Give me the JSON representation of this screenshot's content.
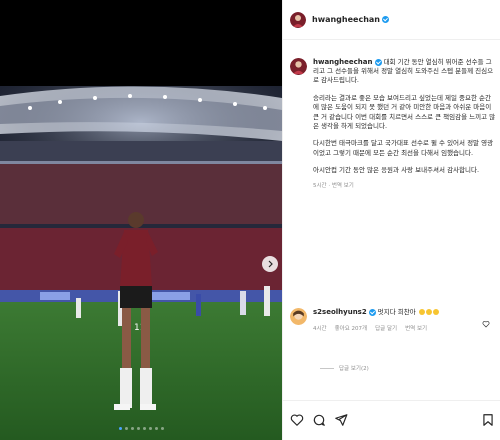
{
  "post": {
    "username": "hwangheechan",
    "caption": [
      "대회 기간 동안 열심히 뛰어준 선수들 그리고 그 선수들을 위해서 정말 열심히 도와주신 스텝 분들께 진심으로 감사드립니다.",
      "승리라는 결과로 좋은 모습 보여드리고 싶었는데 제일 중요한 순간에 많은 도움이 되지 못 했던 거 같아 미안한 마음과 아쉬운 마음이 큰 거 같습니다 이번 대회를 치르면서 스스로 큰 책임감을 느끼고 많은 생각을 하게 되었습니다.",
      "다시한번 태극마크를 달고 국가대표 선수로 뛸 수 있어서 정말 영광이었고 그렇기 때문에 모든 순간 최선을 다해서 임했습니다.",
      "아시안컵 기간 동안 많은 응원과 사랑 보내주셔서 감사합니다."
    ],
    "caption_meta": "5시간 · 번역 보기"
  },
  "comment": {
    "username": "s2seolhyuns2",
    "text": "멋지다 희찬아",
    "emoji_count": 3,
    "meta": [
      "4시간",
      "좋아요 207개",
      "답글 달기",
      "번역 보기"
    ]
  },
  "replies_label": "답글 보기(2)",
  "media": {
    "player_number": "11",
    "slide_count": 8,
    "active_slide": 1
  },
  "colors": {
    "verified": "#1d9bf0",
    "pitch": "#2f6e2a",
    "jersey": "#7a1f2a"
  },
  "icons": [
    "heart-icon",
    "comment-icon",
    "share-icon",
    "bookmark-icon",
    "chevron-right-icon"
  ]
}
